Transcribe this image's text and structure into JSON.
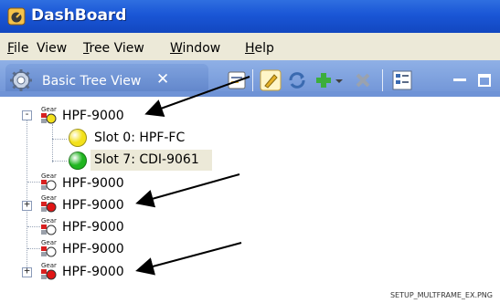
{
  "window": {
    "title": "DashBoard"
  },
  "menu": [
    {
      "pre": "",
      "ul": "F",
      "post": "ile"
    },
    {
      "pre": "View",
      "ul": "",
      "post": ""
    },
    {
      "pre": "",
      "ul": "T",
      "post": "ree View"
    },
    {
      "pre": "",
      "ul": "W",
      "post": "indow"
    },
    {
      "pre": "",
      "ul": "H",
      "post": "elp"
    }
  ],
  "tab": {
    "label": "Basic Tree View",
    "close": "✕"
  },
  "icons": {
    "app": "dashboard-app-icon",
    "tab": "gear-tab-icon",
    "tools": [
      "collapse-all-icon",
      "edit-icon",
      "refresh-icon",
      "add-icon",
      "dropdown-arrow-icon",
      "delete-icon",
      "properties-icon",
      "minimize-icon",
      "maximize-icon"
    ]
  },
  "tree": [
    {
      "label": "HPF-9000",
      "expander": "-",
      "status": "yellow"
    },
    {
      "label": "Slot 0: HPF-FC",
      "status": "yellow"
    },
    {
      "label": "Slot 7: CDI-9061",
      "status": "green",
      "selected": true
    },
    {
      "label": "HPF-9000",
      "status": "none"
    },
    {
      "label": "HPF-9000",
      "expander": "+",
      "status": "red"
    },
    {
      "label": "HPF-9000",
      "status": "none"
    },
    {
      "label": "HPF-9000",
      "status": "none"
    },
    {
      "label": "HPF-9000",
      "expander": "+",
      "status": "red"
    }
  ],
  "gear_badge": "Gear",
  "colors": {
    "yellow": "#f3e11a",
    "green": "#1fb51f",
    "red": "#e01515",
    "titlebar": "#1a56d6"
  },
  "caption": "SETUP_MULTFRAME_EX.PNG"
}
